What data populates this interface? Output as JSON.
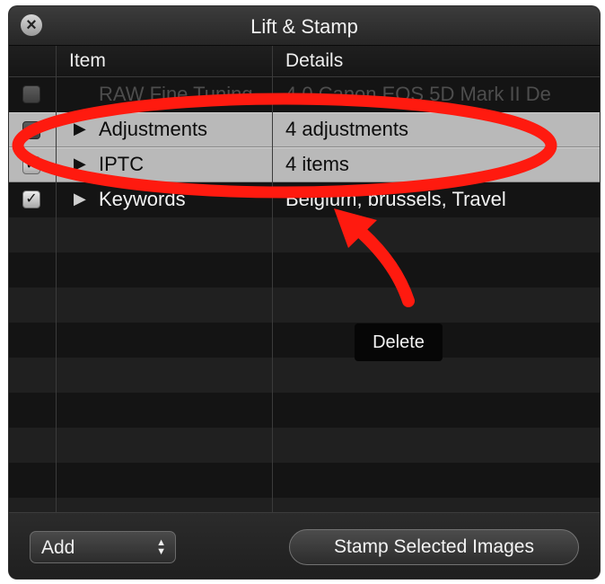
{
  "window": {
    "title": "Lift & Stamp"
  },
  "table": {
    "headers": {
      "item": "Item",
      "details": "Details"
    },
    "rows": [
      {
        "item": "RAW Fine Tuning",
        "details": "4.0 Canon EOS 5D Mark II De",
        "checked": false,
        "expandable": false,
        "state": "dimmed"
      },
      {
        "item": "Adjustments",
        "details": "4 adjustments",
        "checked": false,
        "expandable": true,
        "state": "selected"
      },
      {
        "item": "IPTC",
        "details": "4 items",
        "checked": true,
        "expandable": true,
        "state": "selected"
      },
      {
        "item": "Keywords",
        "details": "Belgium, brussels, Travel",
        "checked": true,
        "expandable": true,
        "state": "normal"
      }
    ]
  },
  "footer": {
    "add_label": "Add",
    "stamp_label": "Stamp Selected Images"
  },
  "tooltip": {
    "text": "Delete"
  },
  "annotation": {
    "color": "#ff1a0f",
    "shapes": [
      "ellipse",
      "arrow"
    ]
  },
  "icons": {
    "close": "close-icon",
    "checkmark": "checkmark-icon",
    "disclosure": "disclosure-triangle-icon",
    "popup_arrows": "updown-arrows-icon"
  }
}
